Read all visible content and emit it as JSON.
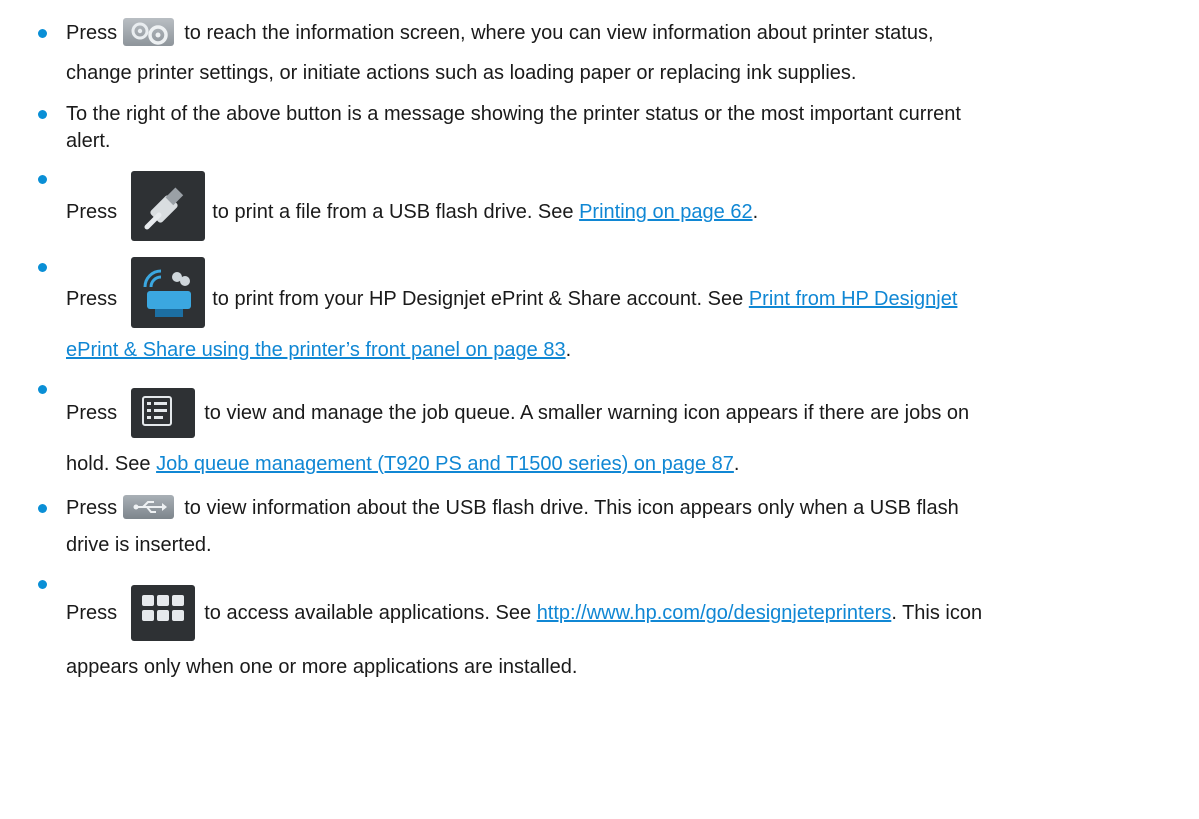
{
  "items": [
    {
      "id": "info",
      "icon": "gear-settings-icon",
      "l1_a": "Press",
      "l1_b": "to reach the information screen, where you can view information about printer status,",
      "l2": "change printer settings, or initiate actions such as loading paper or replacing ink supplies."
    },
    {
      "id": "status",
      "l1": "To the right of the above button is a message showing the printer status or the most important current",
      "l2": "alert."
    },
    {
      "id": "usb-print",
      "icon": "usb-flash-drive-icon",
      "a": "Press",
      "b": "to print a file from a USB flash drive. See",
      "link": "Printing on page 62",
      "end": "."
    },
    {
      "id": "eprint",
      "icon": "eprint-share-icon",
      "a": "Press",
      "b": "to print from your HP Designjet ePrint & Share account. See",
      "link1": "Print from HP Designjet",
      "link2": "ePrint & Share using the printer’s front panel on page 83",
      "end": "."
    },
    {
      "id": "job-queue",
      "icon": "job-queue-icon",
      "a": "Press",
      "b": "to view and manage the job queue. A smaller warning icon appears if there are jobs on",
      "c": "hold. See",
      "link": "Job queue management (T920 PS and T1500 series) on page 87",
      "end": "."
    },
    {
      "id": "usb-info",
      "icon": "usb-symbol-icon",
      "a": "Press",
      "b": "to view information about the USB flash drive. This icon appears only when a USB flash",
      "l2": "drive is inserted."
    },
    {
      "id": "apps",
      "icon": "applications-grid-icon",
      "a": "Press",
      "b": "to access available applications. See",
      "link": "http://www.hp.com/go/designjeteprinters",
      "c": ". This icon",
      "l2": "appears only when one or more applications are installed."
    }
  ],
  "colors": {
    "bullet": "#0a8fd6",
    "link": "#1087d4",
    "tile": "#2e3134"
  }
}
